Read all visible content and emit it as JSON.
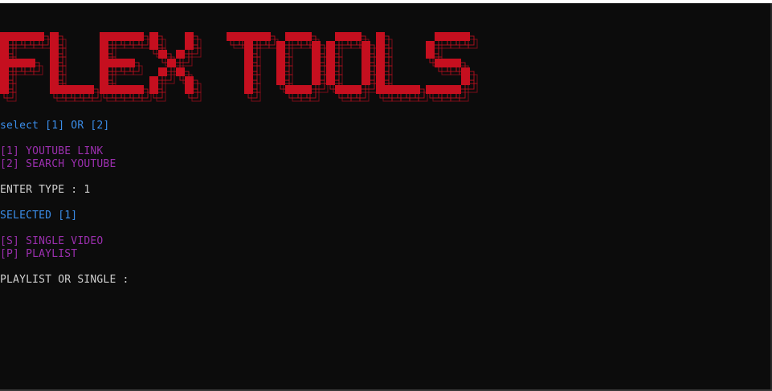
{
  "window": {
    "title": "FLEX TOOLS"
  },
  "banner": {
    "text": "FLEX TOOLS",
    "color": "#c50f1f"
  },
  "colors": {
    "background": "#0c0c0c",
    "prompt_blue": "#3b8eea",
    "option_purple": "#9b2fae",
    "input_white": "#d0d0d0"
  },
  "console": {
    "select_prompt": "select [1] OR [2]",
    "option_1": "[1] YOUTUBE LINK",
    "option_2": "[2] SEARCH YOUTUBE",
    "enter_type": "ENTER TYPE : 1",
    "selected": "SELECTED [1]",
    "option_s": "[S] SINGLE VIDEO",
    "option_p": "[P] PLAYLIST",
    "playlist_prompt": "PLAYLIST OR SINGLE :"
  }
}
